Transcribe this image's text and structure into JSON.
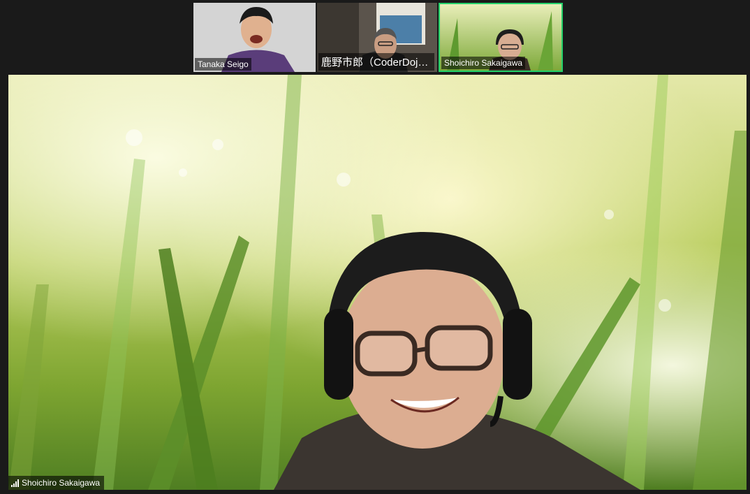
{
  "participants": [
    {
      "name": "Tanaka Seigo"
    },
    {
      "name": "鹿野市郎（CoderDojo青..."
    },
    {
      "name": "Shoichiro Sakaigawa"
    }
  ],
  "main_speaker": {
    "name": "Shoichiro Sakaigawa"
  },
  "colors": {
    "active_speaker_border": "#24d16a"
  },
  "icons": {
    "connection": "signal-bars-icon"
  }
}
